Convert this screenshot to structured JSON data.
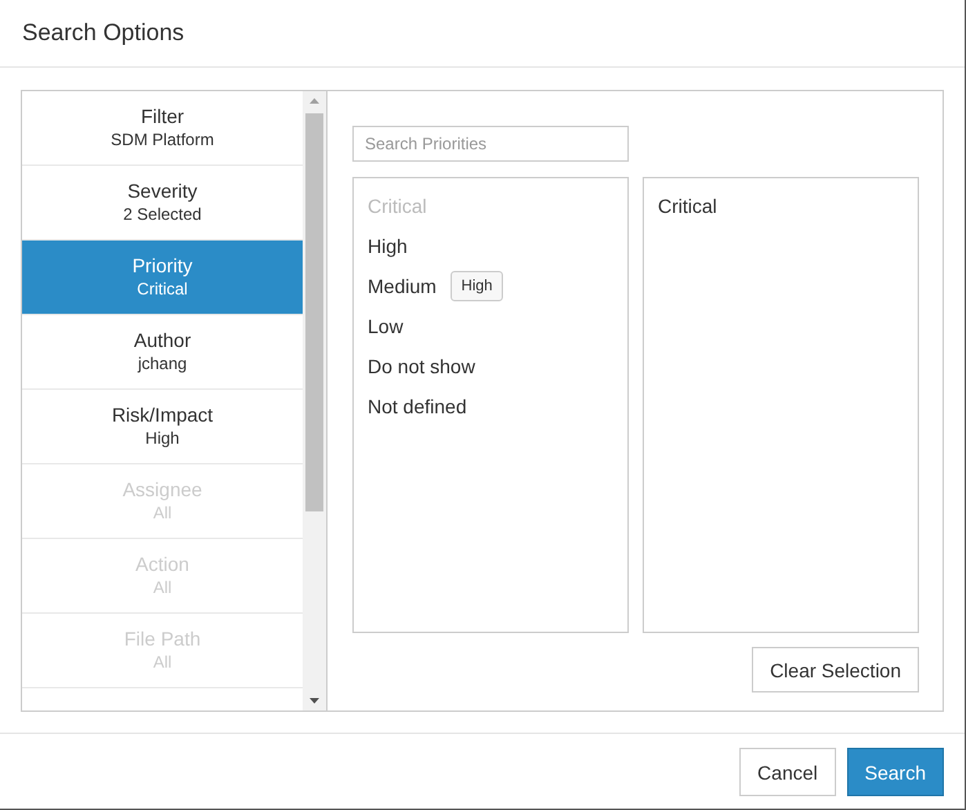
{
  "window": {
    "title": "Search Options"
  },
  "sidebar": {
    "items": [
      {
        "label": "Filter",
        "value": "SDM Platform",
        "selected": false,
        "disabled": false
      },
      {
        "label": "Severity",
        "value": "2 Selected",
        "selected": false,
        "disabled": false
      },
      {
        "label": "Priority",
        "value": "Critical",
        "selected": true,
        "disabled": false
      },
      {
        "label": "Author",
        "value": "jchang",
        "selected": false,
        "disabled": false
      },
      {
        "label": "Risk/Impact",
        "value": "High",
        "selected": false,
        "disabled": false
      },
      {
        "label": "Assignee",
        "value": "All",
        "selected": false,
        "disabled": true
      },
      {
        "label": "Action",
        "value": "All",
        "selected": false,
        "disabled": true
      },
      {
        "label": "File Path",
        "value": "All",
        "selected": false,
        "disabled": true
      }
    ]
  },
  "search": {
    "placeholder": "Search Priorities"
  },
  "available": [
    {
      "label": "Critical",
      "disabled": true
    },
    {
      "label": "High",
      "disabled": false
    },
    {
      "label": "Medium",
      "disabled": false
    },
    {
      "label": "Low",
      "disabled": false
    },
    {
      "label": "Do not show",
      "disabled": false
    },
    {
      "label": "Not defined",
      "disabled": false
    }
  ],
  "tooltip": {
    "text": "High"
  },
  "chosen": [
    {
      "label": "Critical"
    }
  ],
  "clear_button": "Clear Selection",
  "buttons": [
    {
      "label": "Cancel",
      "kind": "secondary"
    },
    {
      "label": "Search",
      "kind": "primary"
    }
  ]
}
